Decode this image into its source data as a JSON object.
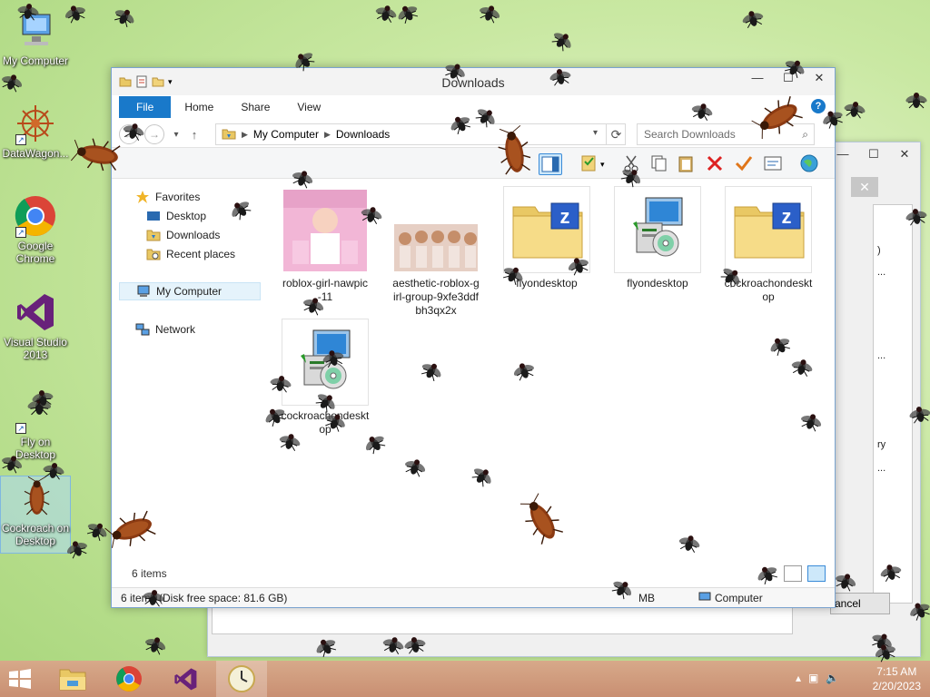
{
  "desktop": {
    "icons": [
      {
        "label": "My Computer",
        "icon": "computer-icon"
      },
      {
        "label": "DataWagon...",
        "icon": "datawagon-icon"
      },
      {
        "label": "Google Chrome",
        "icon": "chrome-icon"
      },
      {
        "label": "Visual Studio 2013",
        "icon": "visual-studio-icon"
      },
      {
        "label": "Fly on Desktop",
        "icon": "fly-icon"
      },
      {
        "label": "Cockroach on Desktop",
        "icon": "cockroach-icon"
      }
    ]
  },
  "background_window": {
    "cancel_label": "ancel",
    "panel_texts": [
      ")",
      "...",
      "...",
      "ry",
      "..."
    ]
  },
  "explorer": {
    "title": "Downloads",
    "tabs": [
      "File",
      "Home",
      "Share",
      "View"
    ],
    "address": {
      "root": "My Computer",
      "current": "Downloads"
    },
    "search_placeholder": "Search Downloads",
    "nav": {
      "favorites": "Favorites",
      "desktop": "Desktop",
      "downloads": "Downloads",
      "recent": "Recent places",
      "my_computer": "My Computer",
      "network": "Network"
    },
    "files": [
      {
        "name": "roblox-girl-nawpic-11",
        "type": "image"
      },
      {
        "name": "aesthetic-roblox-girl-group-9xfe3ddfbh3qx2x",
        "type": "image"
      },
      {
        "name": "flyondesktop",
        "type": "zip"
      },
      {
        "name": "flyondesktop",
        "type": "installer"
      },
      {
        "name": "cockroachondesktop",
        "type": "zip"
      },
      {
        "name": "cockroachondesktop",
        "type": "installer"
      }
    ],
    "item_count": "6 items",
    "statusbar": {
      "left": "6 items (Disk free space: 81.6 GB)",
      "size": "MB",
      "location": "Computer"
    }
  },
  "taskbar": {
    "apps": [
      "start-icon",
      "file-explorer-icon",
      "chrome-icon",
      "visual-studio-icon",
      "clock-app-icon"
    ],
    "time": "7:15 AM",
    "date": "2/20/2023"
  },
  "colors": {
    "accent": "#1979ca",
    "taskbar": "#cc9477",
    "desktop": "#b8dd8c"
  }
}
